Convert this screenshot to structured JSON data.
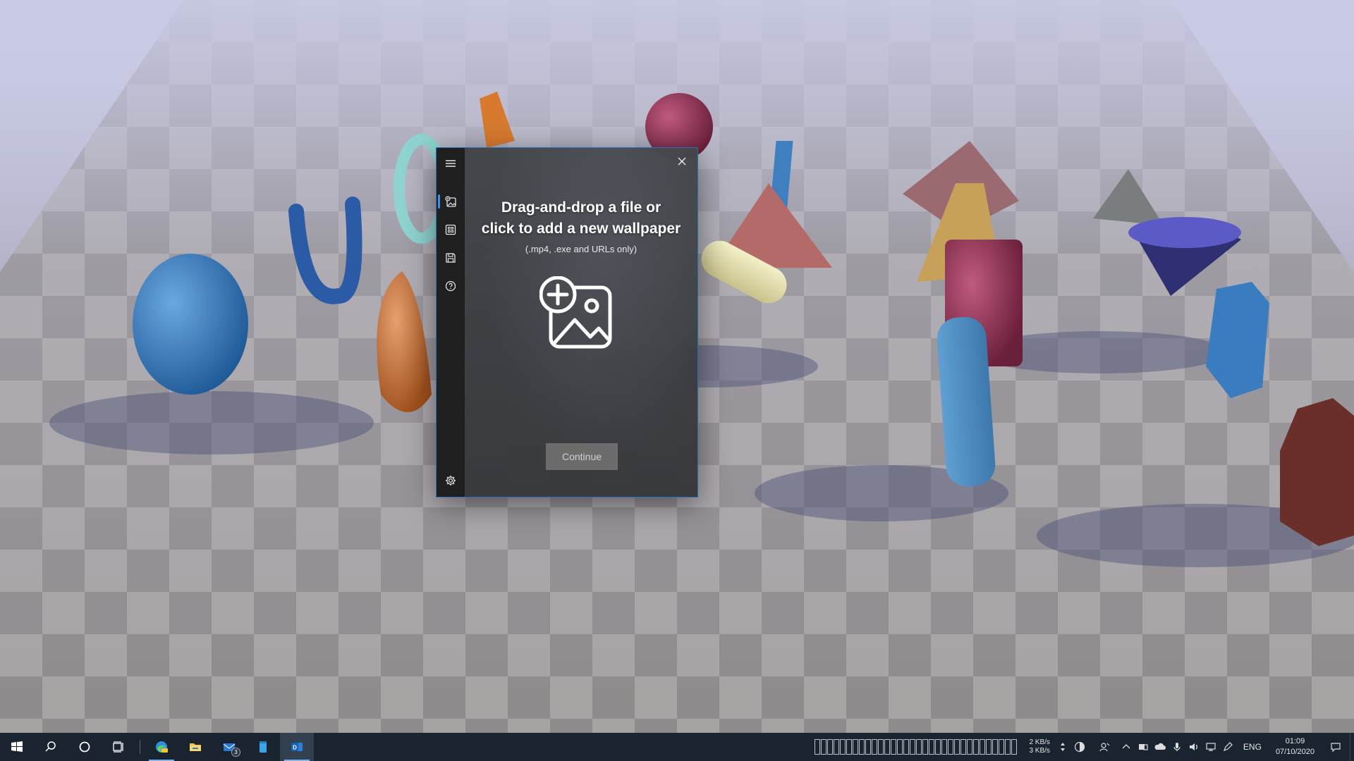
{
  "app": {
    "drop_title_line1": "Drag-and-drop a file or",
    "drop_title_line2": "click to add a new wallpaper",
    "drop_subtitle": "(.mp4, .exe and URLs only)",
    "continue_label": "Continue",
    "sidebar_icons": [
      "hamburger-menu-icon",
      "add-wallpaper-icon",
      "library-icon",
      "save-icon",
      "help-icon",
      "settings-icon"
    ],
    "accent_color": "#3c8ee6"
  },
  "taskbar": {
    "apps": [
      "start-icon",
      "search-icon",
      "cortana-icon",
      "task-view-icon",
      "edge-canary-icon",
      "file-explorer-icon",
      "mail-icon",
      "notepad-icon",
      "outlook-icon"
    ],
    "mail_badge": "3",
    "net_up": "2 KB/s",
    "net_down": "3 KB/s",
    "language": "ENG",
    "time": "01:09",
    "date": "07/10/2020",
    "background_color": "#1a2330"
  }
}
